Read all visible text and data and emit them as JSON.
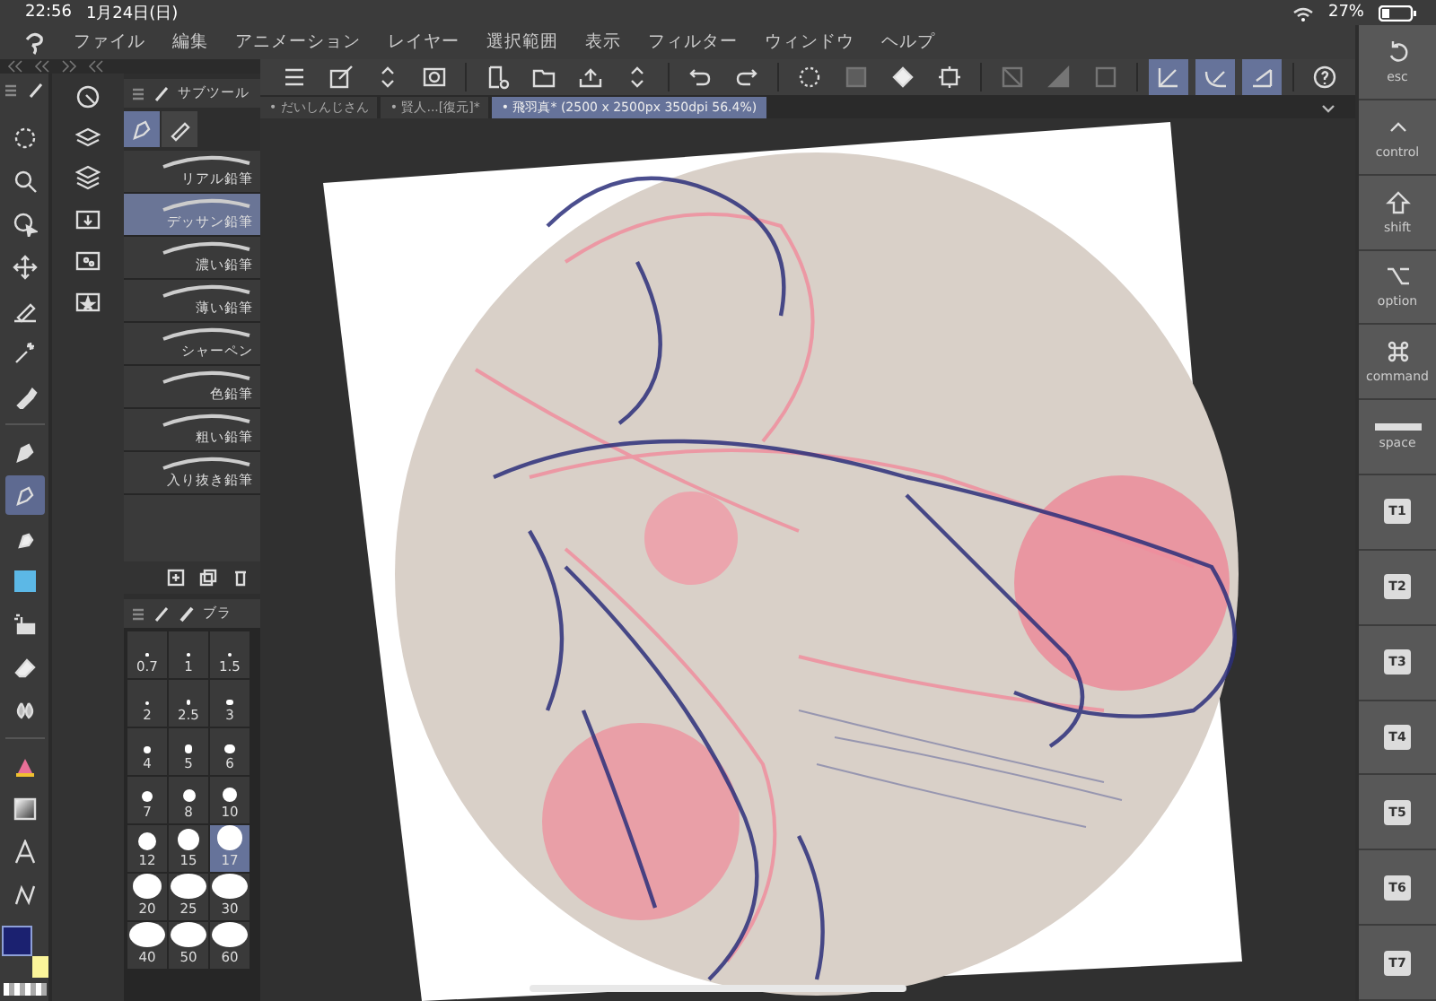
{
  "status_bar": {
    "time": "22:56",
    "date": "1月24日(日)",
    "battery": "27%"
  },
  "menu": [
    "ファイル",
    "編集",
    "アニメーション",
    "レイヤー",
    "選択範囲",
    "表示",
    "フィルター",
    "ウィンドウ",
    "ヘルプ"
  ],
  "toolbar": [
    {
      "on": false,
      "disabled": false
    },
    {
      "on": false,
      "disabled": false
    },
    {
      "on": false,
      "disabled": false
    },
    {
      "on": false,
      "disabled": false
    },
    {
      "on": false,
      "disabled": false
    },
    {
      "on": false,
      "disabled": false
    },
    {
      "on": false,
      "disabled": false
    },
    {
      "on": false,
      "disabled": false
    },
    {
      "on": false,
      "disabled": false
    },
    {
      "on": false,
      "disabled": false
    },
    {
      "on": false,
      "disabled": false
    },
    {
      "on": false,
      "disabled": true
    },
    {
      "on": false,
      "disabled": false
    },
    {
      "on": false,
      "disabled": false
    },
    {
      "on": false,
      "disabled": true
    },
    {
      "on": false,
      "disabled": true
    },
    {
      "on": false,
      "disabled": true
    },
    {
      "on": true,
      "disabled": false
    },
    {
      "on": true,
      "disabled": false
    },
    {
      "on": true,
      "disabled": false
    },
    {
      "on": false,
      "disabled": false
    }
  ],
  "tabs": [
    {
      "label": "• だいしんじさん",
      "selected": false
    },
    {
      "label": "• 賢人...[復元]*",
      "selected": false
    },
    {
      "label": "• 飛羽真* (2500 x 2500px 350dpi 56.4%)",
      "selected": true
    }
  ],
  "tools": [
    {
      "selected": false
    },
    {
      "selected": false
    },
    {
      "selected": false
    },
    {
      "selected": false
    },
    {
      "selected": false
    },
    {
      "selected": false
    },
    {
      "selected": false
    },
    {
      "selected": false
    },
    {
      "selected": true
    },
    {
      "selected": false
    },
    {
      "selected": false
    },
    {
      "selected": false
    },
    {
      "selected": false
    },
    {
      "selected": false
    },
    {
      "selected": false
    },
    {
      "selected": false
    },
    {
      "selected": false
    },
    {
      "selected": false
    }
  ],
  "color_swatches": [
    {
      "kind": "main",
      "color": "#1b2170"
    },
    {
      "kind": "sub",
      "color": "#fbf59a"
    }
  ],
  "sub_tool_panel": {
    "title": "サブツール",
    "groups": [
      {
        "selected": true
      },
      {
        "selected": false
      }
    ],
    "items": [
      {
        "label": "リアル鉛筆",
        "selected": false
      },
      {
        "label": "デッサン鉛筆",
        "selected": true
      },
      {
        "label": "濃い鉛筆",
        "selected": false
      },
      {
        "label": "薄い鉛筆",
        "selected": false
      },
      {
        "label": "シャーペン",
        "selected": false
      },
      {
        "label": "色鉛筆",
        "selected": false
      },
      {
        "label": "粗い鉛筆",
        "selected": false
      },
      {
        "label": "入り抜き鉛筆",
        "selected": false
      }
    ]
  },
  "brush_size_panel": {
    "title": "ブラ",
    "sizes": [
      {
        "label": "0.7",
        "selected": false
      },
      {
        "label": "1",
        "selected": false
      },
      {
        "label": "1.5",
        "selected": false
      },
      {
        "label": "2",
        "selected": false
      },
      {
        "label": "2.5",
        "selected": false
      },
      {
        "label": "3",
        "selected": false
      },
      {
        "label": "4",
        "selected": false
      },
      {
        "label": "5",
        "selected": false
      },
      {
        "label": "6",
        "selected": false
      },
      {
        "label": "7",
        "selected": false
      },
      {
        "label": "8",
        "selected": false
      },
      {
        "label": "10",
        "selected": false
      },
      {
        "label": "12",
        "selected": false
      },
      {
        "label": "15",
        "selected": false
      },
      {
        "label": "17",
        "selected": true
      },
      {
        "label": "20",
        "selected": false
      },
      {
        "label": "25",
        "selected": false
      },
      {
        "label": "30",
        "selected": false
      },
      {
        "label": "40",
        "selected": false
      },
      {
        "label": "50",
        "selected": false
      },
      {
        "label": "60",
        "selected": false
      }
    ]
  },
  "keys": [
    {
      "kind": "esc",
      "label": "esc"
    },
    {
      "kind": "control",
      "label": "control"
    },
    {
      "kind": "shift",
      "label": "shift"
    },
    {
      "kind": "option",
      "label": "option"
    },
    {
      "kind": "command",
      "label": "command"
    },
    {
      "kind": "space",
      "label": "space"
    },
    {
      "kind": "t",
      "label": "T1"
    },
    {
      "kind": "t",
      "label": "T2"
    },
    {
      "kind": "t",
      "label": "T3"
    },
    {
      "kind": "t",
      "label": "T4"
    },
    {
      "kind": "t",
      "label": "T5"
    },
    {
      "kind": "t",
      "label": "T6"
    },
    {
      "kind": "t",
      "label": "T7"
    }
  ]
}
